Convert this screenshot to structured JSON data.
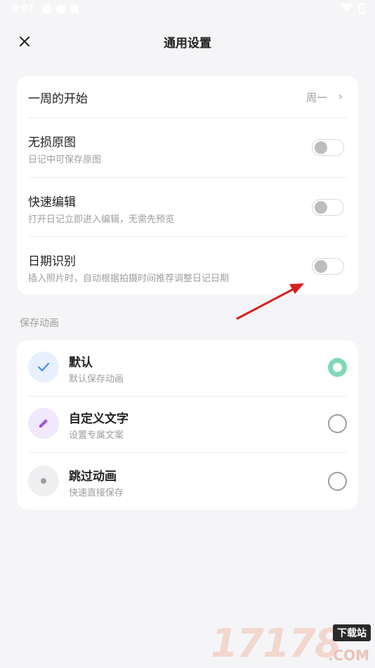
{
  "status_bar": {
    "time": "9:07"
  },
  "header": {
    "title": "通用设置"
  },
  "settings": [
    {
      "title": "一周的开始",
      "value": "周一"
    },
    {
      "title": "无损原图",
      "subtitle": "日记中可保存原图",
      "enabled": false
    },
    {
      "title": "快速编辑",
      "subtitle": "打开日记立即进入编辑，无需先预览",
      "enabled": false
    },
    {
      "title": "日期识别",
      "subtitle": "插入照片时，自动根据拍摄时间推荐调整日记日期",
      "enabled": false
    }
  ],
  "save_animation": {
    "label": "保存动画",
    "options": [
      {
        "title": "默认",
        "subtitle": "默认保存动画",
        "selected": true,
        "icon": "check-icon"
      },
      {
        "title": "自定义文字",
        "subtitle": "设置专属文案",
        "selected": false,
        "icon": "pencil-icon"
      },
      {
        "title": "跳过动画",
        "subtitle": "快速直接保存",
        "selected": false,
        "icon": "dot-icon"
      }
    ]
  },
  "watermark": {
    "number": "17178",
    "tag": "下载站",
    "suffix": ".COM"
  },
  "colors": {
    "accent_radio": "#7fd9b6",
    "arrow": "#d62020",
    "check": "#4a8cf0",
    "pencil": "#9a56e0"
  }
}
